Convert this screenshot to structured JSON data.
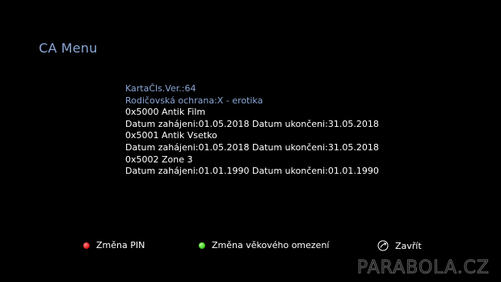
{
  "menu": {
    "title": "CA Menu"
  },
  "card_info": {
    "lines": [
      {
        "text": "KartaČls.Ver.:64",
        "highlight": true
      },
      {
        "text": "Rodičovská ochrana:X - erotika",
        "highlight": true
      },
      {
        "text": "0x5000 Antik Film",
        "highlight": false
      },
      {
        "text": "Datum zahájeni:01.05.2018 Datum ukončeni:31.05.2018",
        "highlight": false
      },
      {
        "text": "0x5001 Antik Vsetko",
        "highlight": false
      },
      {
        "text": "Datum zahájeni:01.05.2018 Datum ukončeni:31.05.2018",
        "highlight": false
      },
      {
        "text": "0x5002 Zone 3",
        "highlight": false
      },
      {
        "text": "Datum zahájeni:01.01.1990 Datum ukončeni:01.01.1990",
        "highlight": false
      }
    ]
  },
  "footer": {
    "red_label": "Změna PIN",
    "green_label": "Změna věkového omezení",
    "exit_label": "Zavřít",
    "red_icon": "red-dot-icon",
    "green_icon": "green-dot-icon",
    "exit_icon": "exit-icon"
  },
  "colors": {
    "background": "#000000",
    "accent": "#8aa6d6",
    "text": "#ffffff"
  },
  "watermark": "PARABOLA.CZ"
}
